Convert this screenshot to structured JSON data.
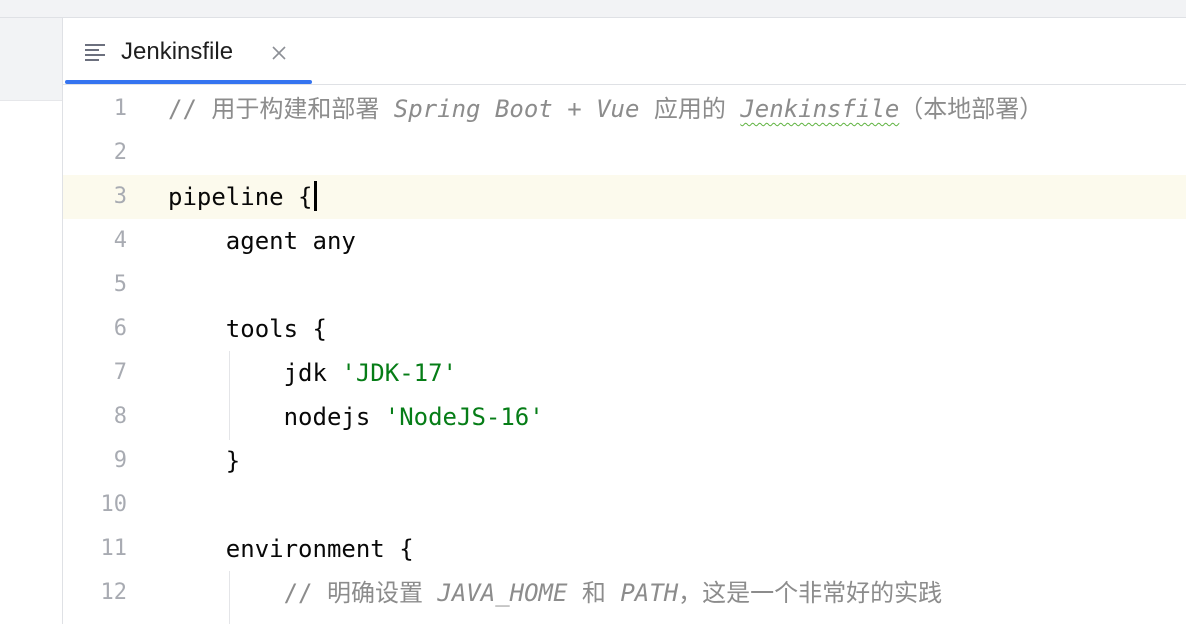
{
  "tab": {
    "label": "Jenkinsfile",
    "file_icon": "text-lines-icon",
    "close_icon": "close-icon"
  },
  "editor": {
    "current_line": 3,
    "lines": [
      {
        "number": "1",
        "comment_prefix": "// 用于构建和部署 ",
        "comment_italic": "Spring Boot + Vue",
        "comment_mid": " 应用的 ",
        "comment_typo": "Jenkinsfile",
        "comment_suffix": "（本地部署）"
      },
      {
        "number": "2"
      },
      {
        "number": "3",
        "code": "pipeline {"
      },
      {
        "number": "4",
        "code": "    agent any"
      },
      {
        "number": "5"
      },
      {
        "number": "6",
        "code": "    tools {"
      },
      {
        "number": "7",
        "code": "        jdk ",
        "string": "'JDK-17'"
      },
      {
        "number": "8",
        "code": "        nodejs ",
        "string": "'NodeJS-16'"
      },
      {
        "number": "9",
        "code": "    }"
      },
      {
        "number": "10"
      },
      {
        "number": "11",
        "code": "    environment {"
      },
      {
        "number": "12",
        "comment_indent": "        ",
        "comment_prefix": "// 明确设置 ",
        "comment_italic": "JAVA_HOME",
        "comment_mid": " 和 ",
        "comment_italic2": "PATH",
        "comment_suffix": "，这是一个非常好的实践"
      }
    ]
  },
  "colors": {
    "keyword_text": "#080808",
    "comment": "#8c8c8c",
    "string": "#067d17",
    "line_number": "#a8abb2",
    "current_line_bg": "#fcfaed",
    "tab_accent": "#3574f0"
  }
}
